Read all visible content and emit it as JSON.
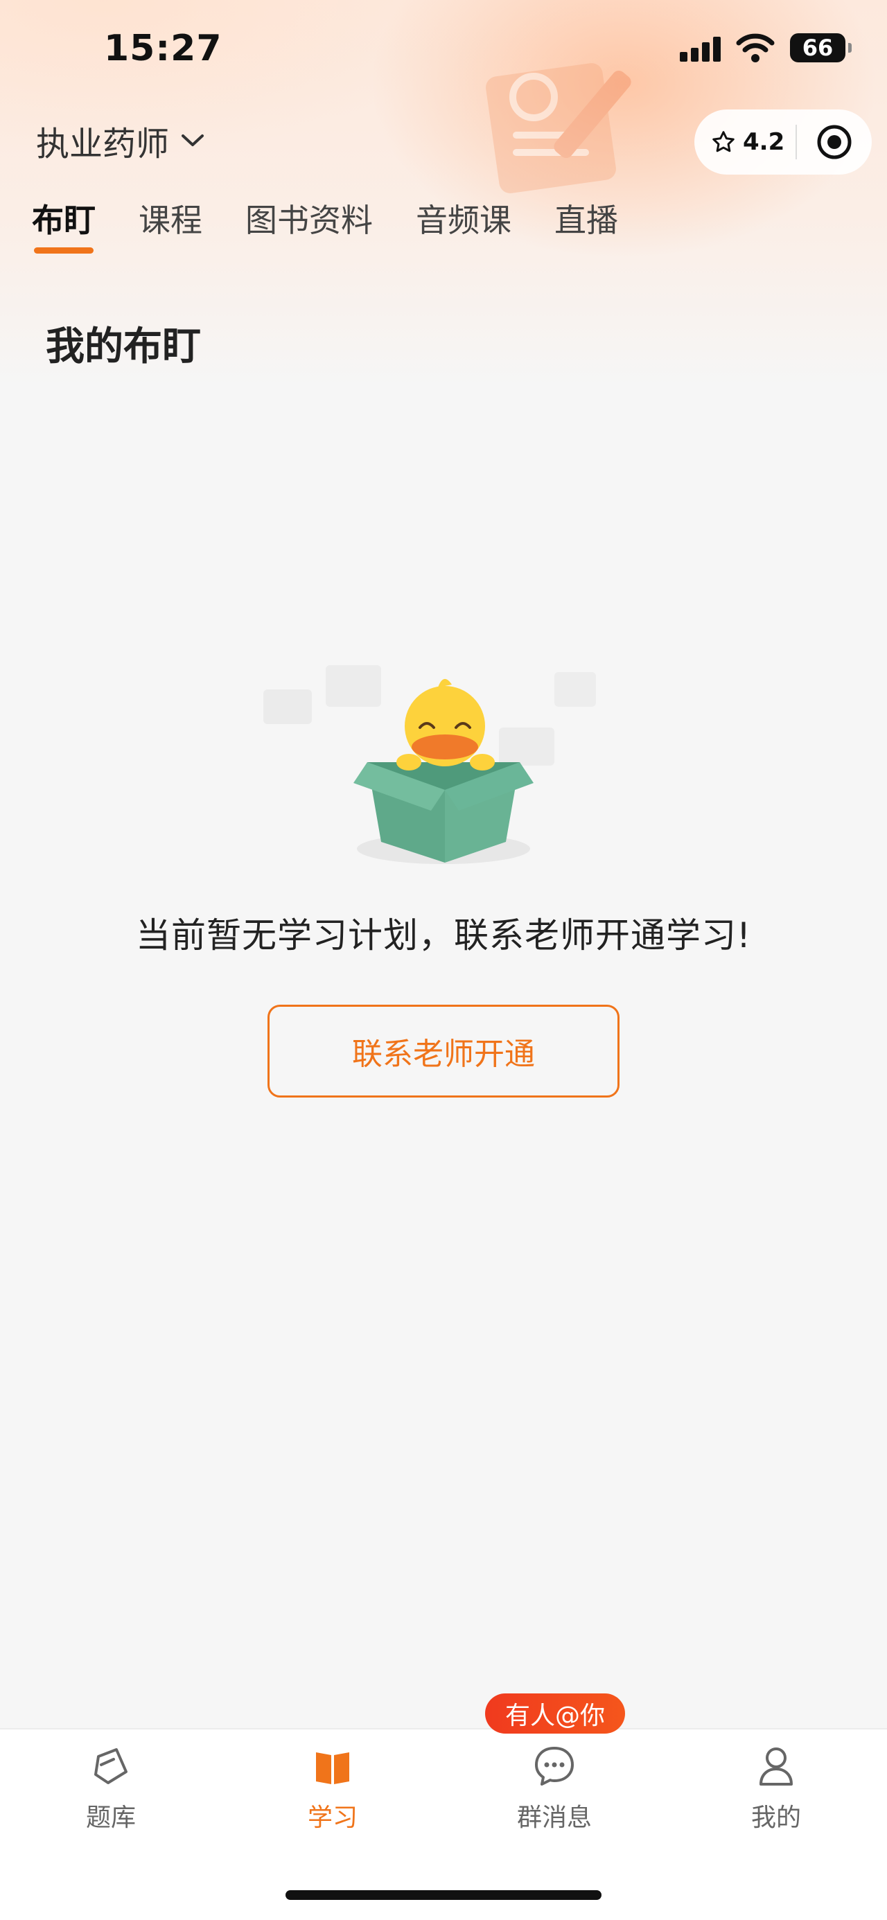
{
  "status_bar": {
    "time": "15:27",
    "battery": "66"
  },
  "header": {
    "exam_name": "执业药师",
    "rating": "4.2"
  },
  "tabs": [
    {
      "label": "布盯",
      "active": true
    },
    {
      "label": "课程",
      "active": false
    },
    {
      "label": "图书资料",
      "active": false
    },
    {
      "label": "音频课",
      "active": false
    },
    {
      "label": "直播",
      "active": false
    }
  ],
  "section": {
    "title": "我的布盯"
  },
  "empty_state": {
    "message": "当前暂无学习计划，联系老师开通学习!",
    "button_label": "联系老师开通"
  },
  "bottom_nav": {
    "mention_badge": "有人@你",
    "items": [
      {
        "label": "题库",
        "icon": "question-bank-icon"
      },
      {
        "label": "学习",
        "icon": "study-book-icon",
        "active": true
      },
      {
        "label": "群消息",
        "icon": "chat-bubble-icon"
      },
      {
        "label": "我的",
        "icon": "profile-icon"
      }
    ]
  },
  "colors": {
    "accent": "#f0741a",
    "badge": "#f03a1e",
    "box_green": "#5fa98a",
    "duck_yellow": "#fdd23c"
  }
}
